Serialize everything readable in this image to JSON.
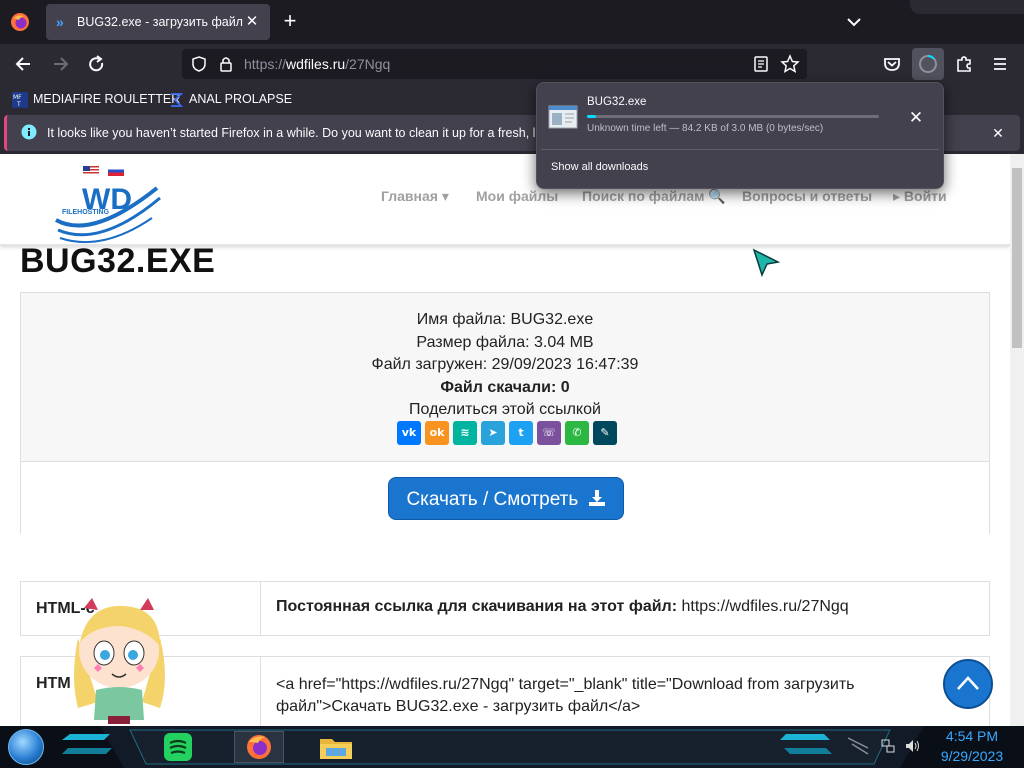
{
  "browser": {
    "tab": {
      "title": "BUG32.exe - загрузить файл",
      "close": "✕"
    },
    "new_tab": "+",
    "url": {
      "protocol": "https://",
      "host": "wdfiles.ru",
      "path": "/27Ngq"
    },
    "bookmarks": [
      {
        "label": "MEDIAFIRE ROULETTER",
        "icon": "mediafire-icon"
      },
      {
        "label": "ANAL PROLAPSE",
        "icon": "sigma-icon"
      }
    ],
    "notification": {
      "text": "It looks like you haven’t started Firefox in a while. Do you want to clean it up for a fresh, like-n",
      "close": "✕"
    }
  },
  "downloads_panel": {
    "filename": "BUG32.exe",
    "progress_fraction": 0.03,
    "status": "Unknown time left — 84.2 KB of 3.0 MB (0 bytes/sec)",
    "cancel": "✕",
    "show_all": "Show all downloads"
  },
  "site": {
    "logo": {
      "text": "WD",
      "subtitle": "FILEHOSTING"
    },
    "nav": [
      {
        "label": "Главная ▾"
      },
      {
        "label": "Мои файлы"
      },
      {
        "label": "Поиск по файлам 🔍"
      },
      {
        "label": "Вопросы и ответы"
      },
      {
        "label": "▸ Войти"
      }
    ],
    "page_title": "BUG32.EXE",
    "file_info": {
      "name_line": "Имя файла: BUG32.exe",
      "size_line": "Размер файла: 3.04 MB",
      "uploaded_line": "Файл загружен: 29/09/2023 16:47:39",
      "downloads_line": "Файл скачали: 0",
      "share_line": "Поделиться этой ссылкой"
    },
    "share_buttons": [
      {
        "name": "vk",
        "color": "#0077ff",
        "glyph": "vk"
      },
      {
        "name": "odnoklassniki",
        "color": "#f7931e",
        "glyph": "ok"
      },
      {
        "name": "yandex-messenger",
        "color": "#00b4a0",
        "glyph": "≋"
      },
      {
        "name": "telegram",
        "color": "#2aa3dd",
        "glyph": "➤"
      },
      {
        "name": "twitter",
        "color": "#1da1f2",
        "glyph": "t"
      },
      {
        "name": "viber",
        "color": "#7b519d",
        "glyph": "☏"
      },
      {
        "name": "whatsapp",
        "color": "#2cb742",
        "glyph": "✆"
      },
      {
        "name": "livejournal",
        "color": "#00485d",
        "glyph": "✎"
      }
    ],
    "download_button": "Скачать / Смотреть",
    "rows": [
      {
        "label": "HTML-с",
        "value_bold": "Постоянная ссылка для скачивания на этот файл:",
        "value": " https://wdfiles.ru/27Ngq"
      },
      {
        "label": "HTM",
        "value_line1": "<a href=\"https://wdfiles.ru/27Ngq\" target=\"_blank\" title=\"Download from загрузить",
        "value_line2": "файл\">Скачать BUG32.exe - загрузить файл</a>"
      }
    ]
  },
  "taskbar": {
    "time": "4:54 PM",
    "date": "9/29/2023",
    "apps": [
      "spotify-icon",
      "firefox-icon",
      "file-explorer-icon"
    ]
  }
}
